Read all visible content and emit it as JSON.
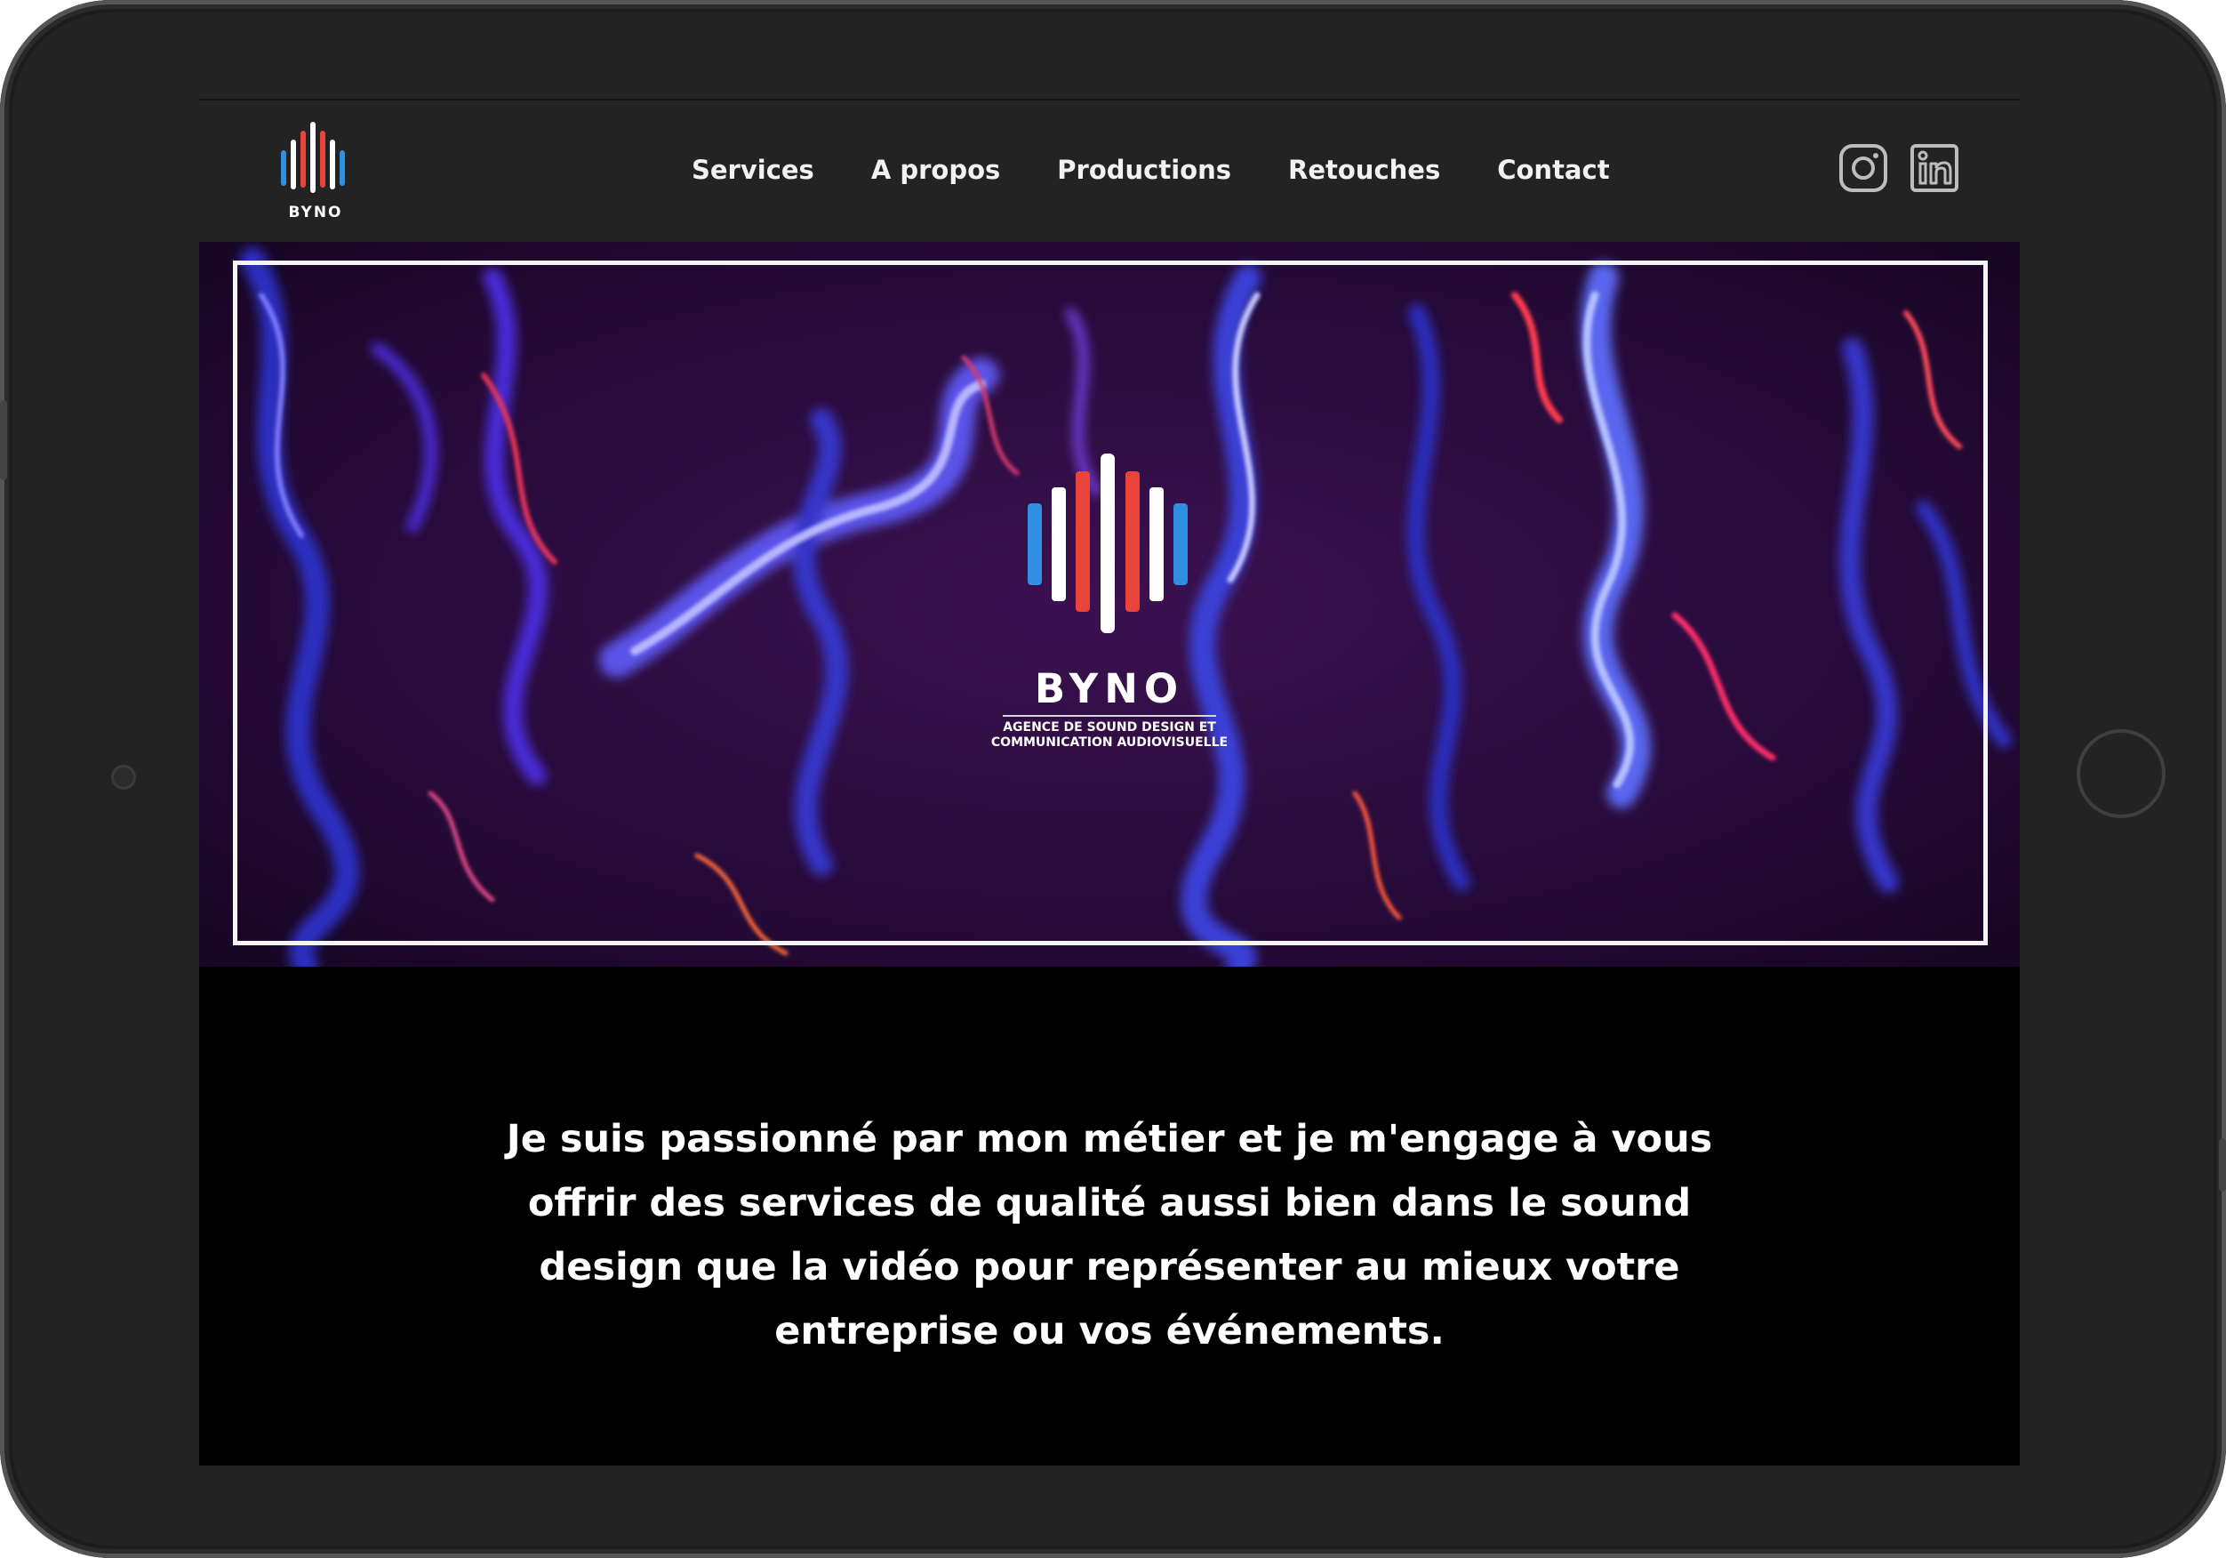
{
  "brand": {
    "name": "BYNO",
    "tagline_line1": "AGENCE DE SOUND DESIGN ET",
    "tagline_line2": "COMMUNICATION AUDIOVISUELLE"
  },
  "nav": {
    "items": [
      {
        "label": "Services"
      },
      {
        "label": "A propos"
      },
      {
        "label": "Productions"
      },
      {
        "label": "Retouches"
      },
      {
        "label": "Contact"
      }
    ]
  },
  "social": [
    {
      "icon": "instagram-icon"
    },
    {
      "icon": "linkedin-icon"
    }
  ],
  "intro": {
    "line1": "Je suis passionné par mon métier et je m'engage à vous",
    "line2": "offrir des services de qualité aussi bien dans le sound",
    "line3": "design que la vidéo pour représenter au mieux votre",
    "line4": "entreprise ou vos événements."
  },
  "colors": {
    "logo_blue": "#2f8fe0",
    "logo_red": "#e8443a",
    "logo_white": "#ffffff",
    "nav_bg": "#232323",
    "hero_bg": "#2a0c3c"
  }
}
